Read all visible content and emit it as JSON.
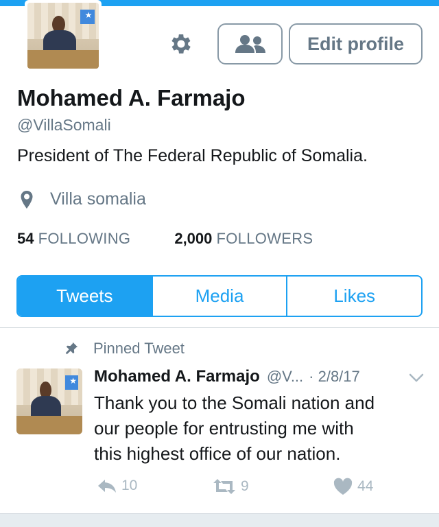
{
  "profile": {
    "name": "Mohamed A. Farmajo",
    "handle": "@VillaSomali",
    "bio": "President of The Federal Republic of Somalia.",
    "location": "Villa somalia",
    "following_count": "54",
    "following_label": "FOLLOWING",
    "followers_count": "2,000",
    "followers_label": "FOLLOWERS"
  },
  "actions": {
    "settings_icon": "gear-icon",
    "people_icon": "people-icon",
    "edit_label": "Edit profile"
  },
  "tabs": [
    {
      "label": "Tweets",
      "active": true
    },
    {
      "label": "Media",
      "active": false
    },
    {
      "label": "Likes",
      "active": false
    }
  ],
  "pinned": {
    "label": "Pinned Tweet",
    "tweet": {
      "name": "Mohamed A. Farmajo",
      "handle": "@V...",
      "date": "· 2/8/17",
      "lines": [
        "Thank you to the Somali nation and",
        "our people for entrusting me with",
        "this highest office of our nation."
      ],
      "replies": "10",
      "retweets": "9",
      "likes": "44"
    }
  },
  "colors": {
    "accent": "#1da1f2",
    "muted": "#657786",
    "icon_muted": "#aab8c2"
  }
}
